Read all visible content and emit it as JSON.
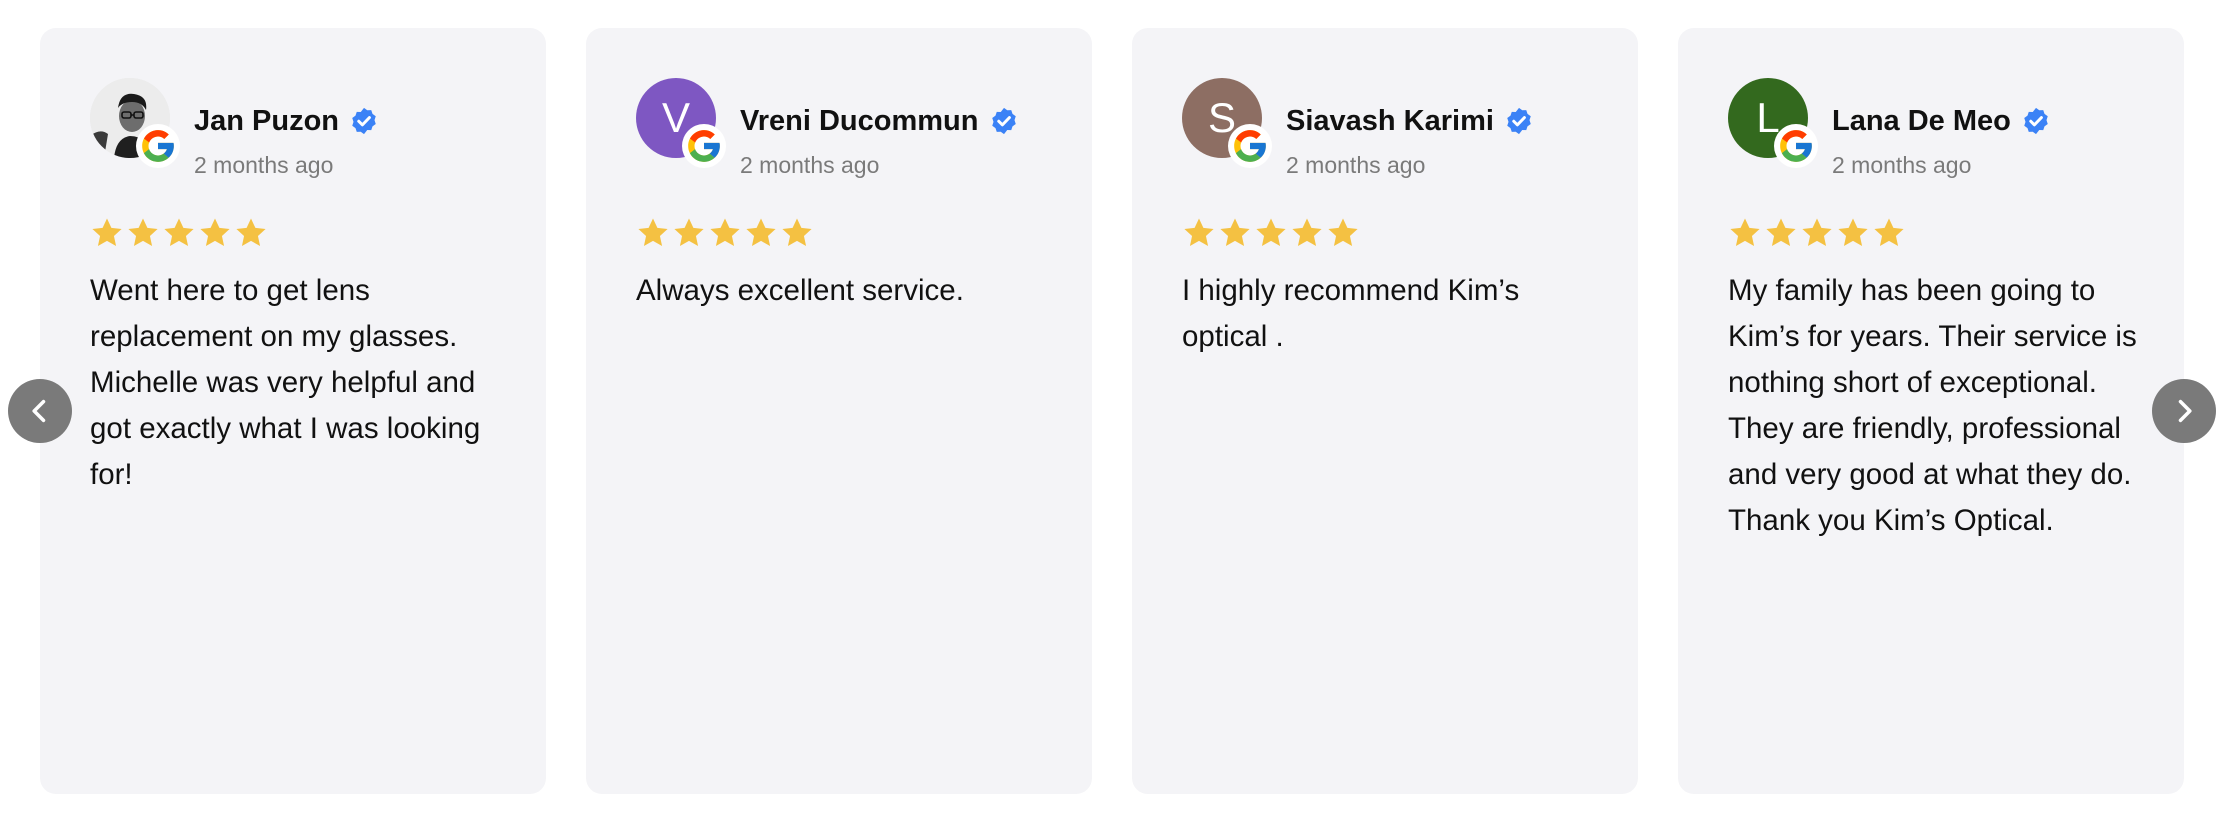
{
  "colors": {
    "card_bg": "#f4f4f7",
    "star": "#f4c142",
    "verified": "#3b82f6",
    "nav_button": "#7a7a7a",
    "name": "#111111",
    "date": "#7a7a7a"
  },
  "navigation": {
    "prev_icon": "chevron-left-icon",
    "next_icon": "chevron-right-icon"
  },
  "reviews": [
    {
      "name": "Jan Puzon",
      "time": "2 months ago",
      "rating": 5,
      "avatar_type": "photo",
      "avatar_letter": "",
      "avatar_color": "#e9e9e9",
      "text": "Went here to get lens replacement on my glasses. Michelle was very helpful and got exactly what I was looking for!"
    },
    {
      "name": "Vreni Ducommun",
      "time": "2 months ago",
      "rating": 5,
      "avatar_type": "letter",
      "avatar_letter": "V",
      "avatar_color": "#7e57c2",
      "text": "Always excellent service."
    },
    {
      "name": "Siavash Karimi",
      "time": "2 months ago",
      "rating": 5,
      "avatar_type": "letter",
      "avatar_letter": "S",
      "avatar_color": "#8d6e63",
      "text": "I highly recommend Kim’s optical ."
    },
    {
      "name": "Lana De Meo",
      "time": "2 months ago",
      "rating": 5,
      "avatar_type": "letter",
      "avatar_letter": "L",
      "avatar_color": "#33691e",
      "text": "My family has been going to Kim’s for years. Their service is nothing short of exceptional. They are friendly, professional and very good at what they do. Thank you Kim’s Optical."
    }
  ]
}
